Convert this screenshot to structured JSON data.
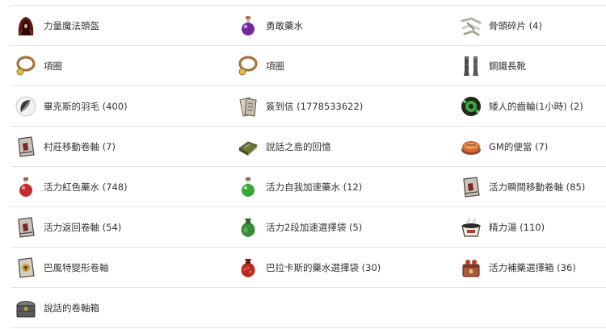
{
  "items": [
    {
      "label": "力量魔法頭盔",
      "icon": "hood-helmet-icon"
    },
    {
      "label": "勇敢藥水",
      "icon": "purple-potion-icon"
    },
    {
      "label": "骨頭碎片 (4)",
      "icon": "bone-fragments-icon"
    },
    {
      "label": "項圈",
      "icon": "necklace-icon"
    },
    {
      "label": "項圈",
      "icon": "necklace-icon"
    },
    {
      "label": "鋼鐵長靴",
      "icon": "steel-boots-icon"
    },
    {
      "label": "畢克斯的羽毛 (400)",
      "icon": "feather-icon"
    },
    {
      "label": "簽到信 (1778533622)",
      "icon": "letter-icon"
    },
    {
      "label": "矮人的齒輪(1小時) (2)",
      "icon": "gear-icon"
    },
    {
      "label": "村莊移動卷軸 (7)",
      "icon": "scroll-icon"
    },
    {
      "label": "說話之島的回憶",
      "icon": "memory-book-icon"
    },
    {
      "label": "GM的便當 (7)",
      "icon": "lunchbox-icon"
    },
    {
      "label": "活力紅色藥水 (748)",
      "icon": "red-potion-icon"
    },
    {
      "label": "活力自我加速藥水 (12)",
      "icon": "green-potion-icon"
    },
    {
      "label": "活力瞬間移動卷軸 (85)",
      "icon": "scroll-icon"
    },
    {
      "label": "活力返回卷軸 (54)",
      "icon": "scroll-icon"
    },
    {
      "label": "活力2段加速選擇袋 (5)",
      "icon": "green-bag-icon"
    },
    {
      "label": "精力湯 (110)",
      "icon": "soup-bowl-icon"
    },
    {
      "label": "巴風特變形卷軸",
      "icon": "transform-scroll-icon"
    },
    {
      "label": "巴拉卡斯的藥水選擇袋 (30)",
      "icon": "red-bag-icon"
    },
    {
      "label": "活力補藥選擇箱 (36)",
      "icon": "potion-box-icon"
    },
    {
      "label": "說話的卷軸箱",
      "icon": "chest-icon"
    }
  ]
}
